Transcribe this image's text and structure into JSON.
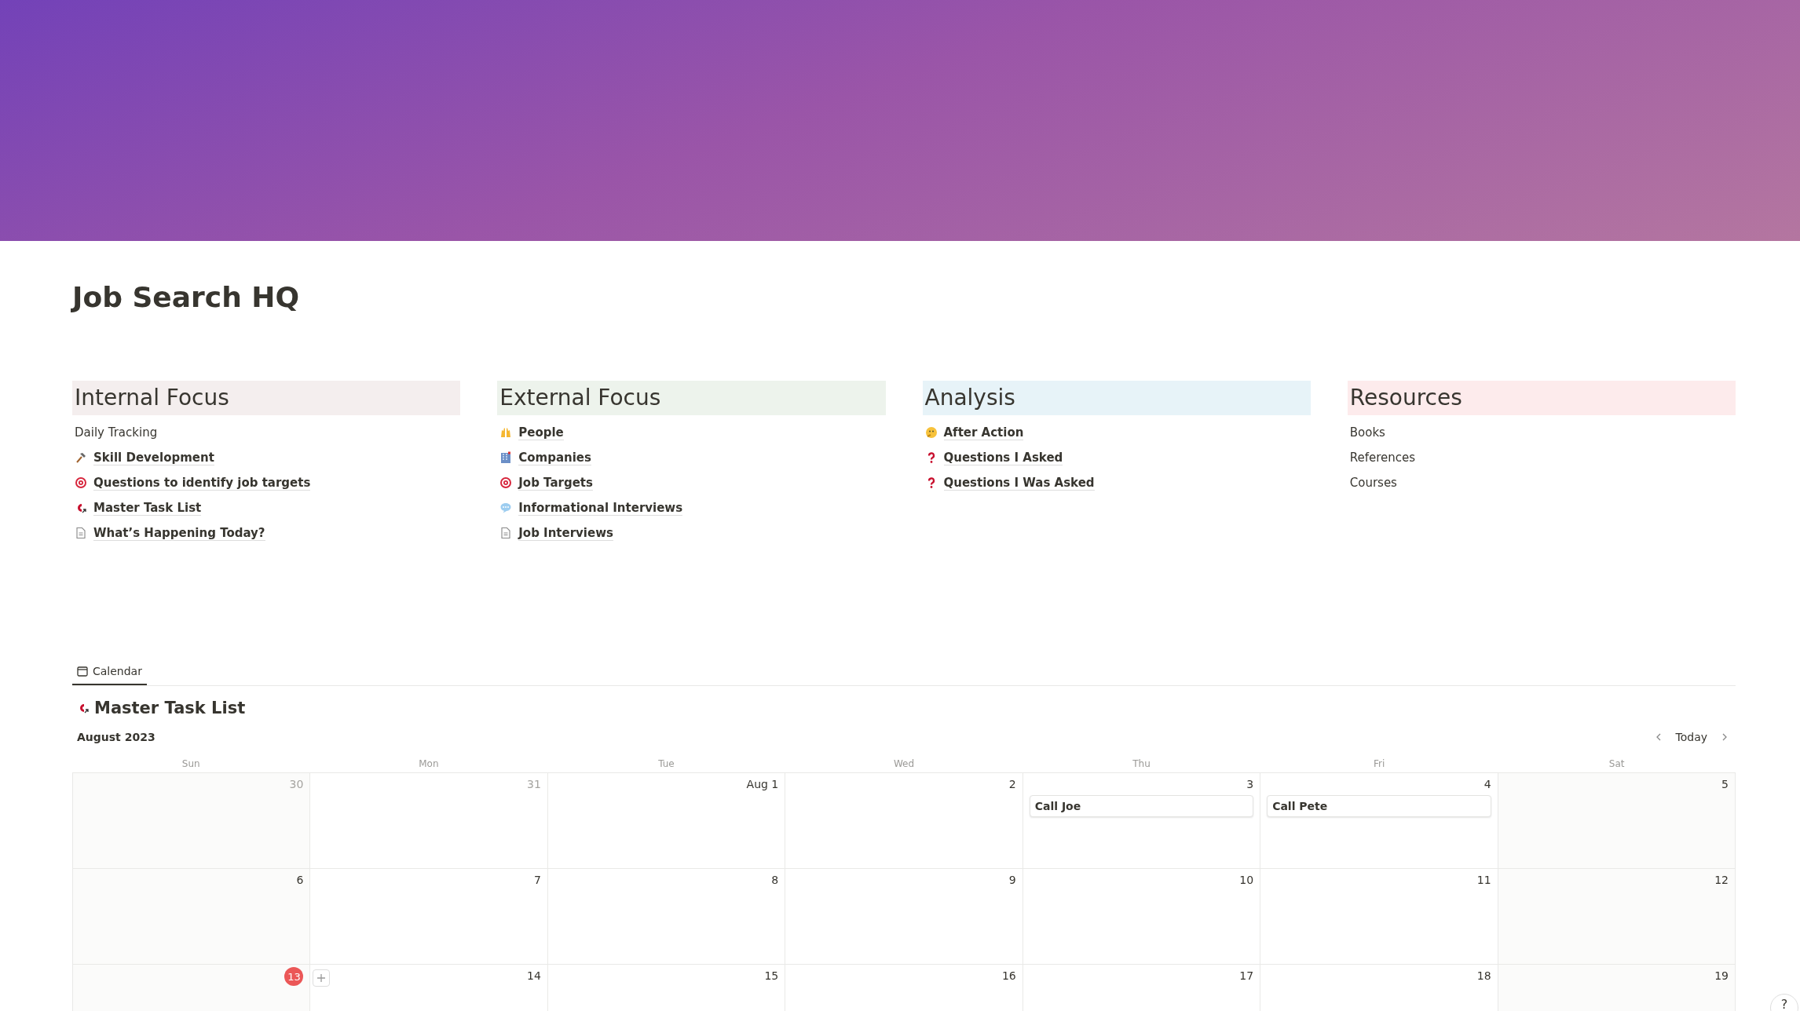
{
  "page": {
    "title": "Job Search HQ"
  },
  "columns": [
    {
      "heading": "Internal Focus",
      "color": "#f4eeee",
      "items": [
        {
          "label": "Daily Tracking",
          "kind": "text"
        },
        {
          "label": "Skill Development",
          "kind": "hammer"
        },
        {
          "label": "Questions to identify job targets",
          "kind": "target"
        },
        {
          "label": "Master Task List",
          "kind": "magnet"
        },
        {
          "label": "What’s Happening Today?",
          "kind": "doc"
        }
      ]
    },
    {
      "heading": "External Focus",
      "color": "#edf3ec",
      "items": [
        {
          "label": "People",
          "kind": "hands"
        },
        {
          "label": "Companies",
          "kind": "building"
        },
        {
          "label": "Job Targets",
          "kind": "target"
        },
        {
          "label": "Informational Interviews",
          "kind": "speech"
        },
        {
          "label": "Job Interviews",
          "kind": "doc"
        }
      ]
    },
    {
      "heading": "Analysis",
      "color": "#e7f3f8",
      "items": [
        {
          "label": "After Action",
          "kind": "thinking"
        },
        {
          "label": "Questions I Asked",
          "kind": "question"
        },
        {
          "label": "Questions I Was Asked",
          "kind": "question"
        }
      ]
    },
    {
      "heading": "Resources",
      "color": "#fdebec",
      "items": [
        {
          "label": "Books",
          "kind": "text"
        },
        {
          "label": "References",
          "kind": "text"
        },
        {
          "label": "Courses",
          "kind": "text"
        }
      ]
    }
  ],
  "view_tabs": [
    {
      "label": "Calendar",
      "selected": true
    }
  ],
  "calendar": {
    "title": "Master Task List",
    "month": "August 2023",
    "today_button": "Today",
    "weekdays": [
      "Sun",
      "Mon",
      "Tue",
      "Wed",
      "Thu",
      "Fri",
      "Sat"
    ],
    "weeks": [
      {
        "days": [
          {
            "label": "30",
            "outside": true
          },
          {
            "label": "31",
            "outside": true
          },
          {
            "label": "Aug 1",
            "outside": false
          },
          {
            "label": "2",
            "outside": false
          },
          {
            "label": "3",
            "outside": false,
            "events": [
              "Call Joe"
            ]
          },
          {
            "label": "4",
            "outside": false,
            "events": [
              "Call Pete"
            ]
          },
          {
            "label": "5",
            "outside": false
          }
        ]
      },
      {
        "days": [
          {
            "label": "6",
            "outside": false
          },
          {
            "label": "7",
            "outside": false
          },
          {
            "label": "8",
            "outside": false
          },
          {
            "label": "9",
            "outside": false
          },
          {
            "label": "10",
            "outside": false
          },
          {
            "label": "11",
            "outside": false
          },
          {
            "label": "12",
            "outside": false
          }
        ]
      },
      {
        "days": [
          {
            "label": "13",
            "today": true
          },
          {
            "label": "14",
            "outside": false
          },
          {
            "label": "15",
            "outside": false
          },
          {
            "label": "16",
            "outside": false
          },
          {
            "label": "17",
            "outside": false
          },
          {
            "label": "18",
            "outside": false
          },
          {
            "label": "19",
            "outside": false
          }
        ]
      }
    ]
  },
  "help_button": {
    "label": "?"
  }
}
